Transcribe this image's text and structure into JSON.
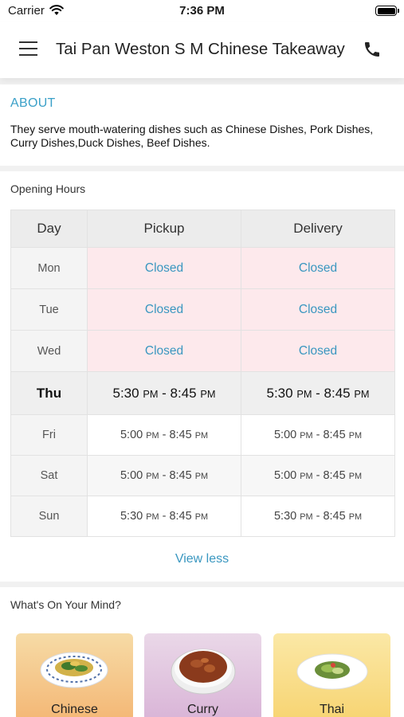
{
  "status_bar": {
    "carrier": "Carrier",
    "time": "7:36 PM"
  },
  "header": {
    "title": "Tai Pan Weston S M Chinese Takeaway",
    "menu_icon": "hamburger-menu-icon",
    "call_icon": "phone-icon"
  },
  "about": {
    "heading": "ABOUT",
    "text": "They serve mouth-watering dishes such as Chinese Dishes, Pork Dishes, Curry Dishes,Duck Dishes, Beef Dishes."
  },
  "opening_hours": {
    "label": "Opening Hours",
    "columns": {
      "day": "Day",
      "pickup": "Pickup",
      "delivery": "Delivery"
    },
    "rows": [
      {
        "day": "Mon",
        "pickup": "Closed",
        "delivery": "Closed"
      },
      {
        "day": "Tue",
        "pickup": "Closed",
        "delivery": "Closed"
      },
      {
        "day": "Wed",
        "pickup": "Closed",
        "delivery": "Closed"
      },
      {
        "day": "Thu",
        "pickup_start": "5:30",
        "pickup_end": "8:45",
        "delivery_start": "5:30",
        "delivery_end": "8:45",
        "pm": "PM",
        "sep": " - "
      },
      {
        "day": "Fri",
        "pickup_start": "5:00",
        "pickup_end": "8:45",
        "delivery_start": "5:00",
        "delivery_end": "8:45",
        "pm": "PM",
        "sep": " - "
      },
      {
        "day": "Sat",
        "pickup_start": "5:00",
        "pickup_end": "8:45",
        "delivery_start": "5:00",
        "delivery_end": "8:45",
        "pm": "PM",
        "sep": " - "
      },
      {
        "day": "Sun",
        "pickup_start": "5:30",
        "pickup_end": "8:45",
        "delivery_start": "5:30",
        "delivery_end": "8:45",
        "pm": "PM",
        "sep": " - "
      }
    ],
    "toggle": "View less"
  },
  "mind": {
    "heading": "What's On Your Mind?",
    "cards": [
      {
        "label": "Chinese"
      },
      {
        "label": "Curry"
      },
      {
        "label": "Thai"
      }
    ]
  },
  "colors": {
    "accent": "#3a97c0",
    "closed_bg": "#fde9ec"
  }
}
